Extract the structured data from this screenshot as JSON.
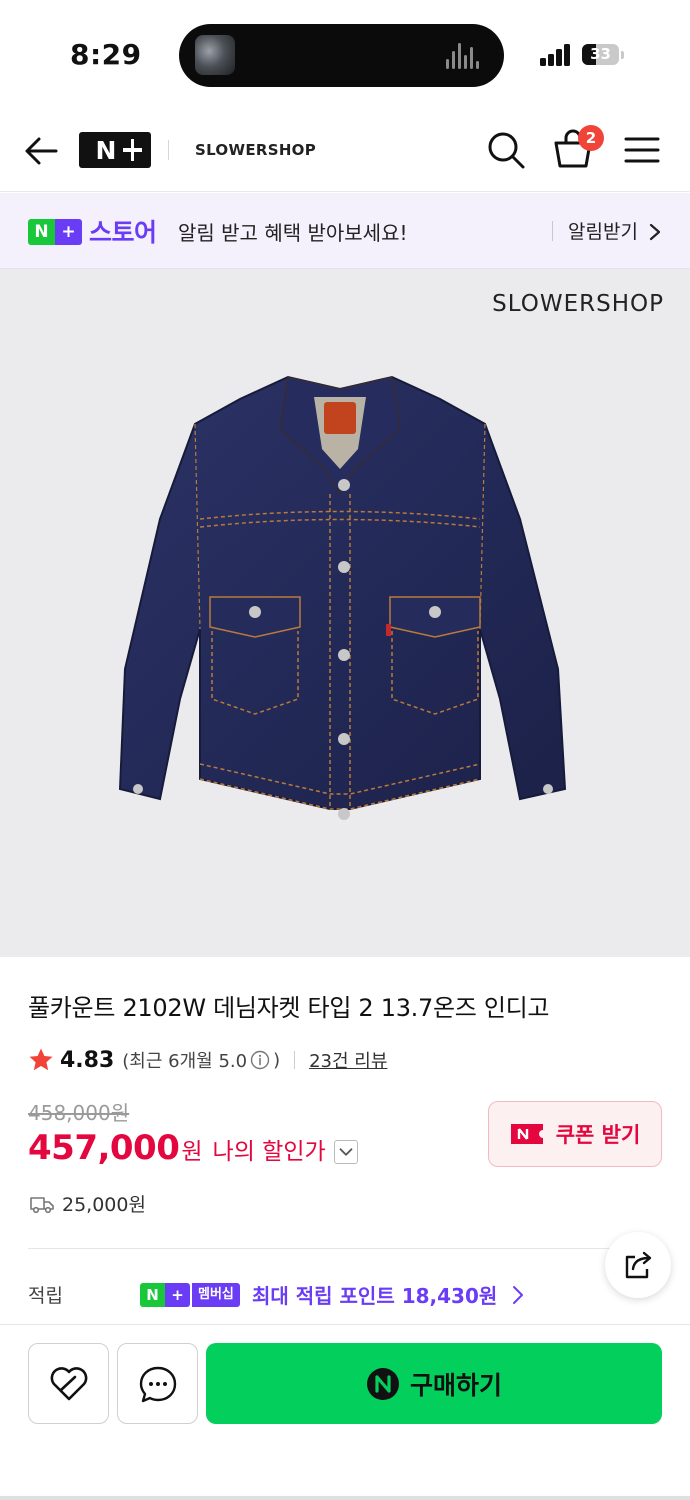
{
  "status_bar": {
    "time": "8:29",
    "battery": "33"
  },
  "header": {
    "logo": "N",
    "shop_name": "SLOWERSHOP",
    "cart_count": "2"
  },
  "banner": {
    "badge_n": "N",
    "badge_plus": "+",
    "store": "스토어",
    "message": "알림 받고 혜택 받아보세요!",
    "link": "알림받기"
  },
  "image": {
    "watermark": "SLOWERSHOP"
  },
  "product": {
    "title": "풀카운트 2102W 데님자켓 타입 2 13.7온즈 인디고",
    "rating": "4.83",
    "rating_detail_prefix": "(최근 6개월 5.0",
    "rating_detail_suffix": ")",
    "review_link": "23건 리뷰",
    "original_price": "458,000원",
    "price": "457,000",
    "price_unit": "원",
    "price_label": "나의 할인가",
    "coupon_label": "쿠폰 받기",
    "shipping": "25,000원"
  },
  "points": {
    "label": "적립",
    "badge_n": "N",
    "badge_plus": "+",
    "badge_membership": "멤버십",
    "text": "최대 적립 포인트 18,430원"
  },
  "bottom": {
    "buy_label": "구매하기"
  },
  "colors": {
    "accent_green": "#03cf5d",
    "naver_purple": "#6b3cf5",
    "price_red": "#e3063f"
  }
}
